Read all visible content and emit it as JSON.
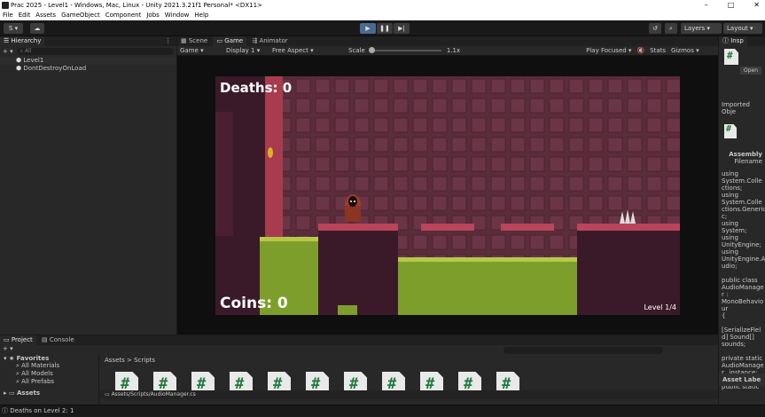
{
  "window": {
    "title": "Prac 2025 - Level1 - Windows, Mac, Linux - Unity 2021.3.21f1 Personal* <DX11>",
    "controls": [
      "–",
      "□",
      "✕"
    ]
  },
  "menu": [
    "File",
    "Edit",
    "Assets",
    "GameObject",
    "Component",
    "Jobs",
    "Window",
    "Help"
  ],
  "toolbar": {
    "account_label": "S ▾",
    "layers_label": "Layers",
    "layout_label": "Layout"
  },
  "hierarchy": {
    "tab_label": "Hierarchy",
    "search_placeholder": "All",
    "items": [
      {
        "label": "Level1"
      },
      {
        "label": "DontDestroyOnLoad"
      }
    ]
  },
  "center_tabs": [
    {
      "label": "Scene"
    },
    {
      "label": "Game"
    },
    {
      "label": "Animator"
    }
  ],
  "game_toolbar": {
    "mode": "Game",
    "display": "Display 1",
    "aspect": "Free Aspect",
    "scale_label": "Scale",
    "scale_value": "1.1x",
    "play_focused": "Play Focused",
    "stats": "Stats",
    "gizmos": "Gizmos"
  },
  "game_view": {
    "deaths_text": "Deaths: 0",
    "coins_text": "Coins: 0",
    "level_text": "Level 1/4"
  },
  "inspector": {
    "tab_label": "Insp",
    "open_button": "Open",
    "imported_label": "Imported Obje",
    "assembly_label": "Assembly",
    "filename_label": "Filename",
    "code_lines": [
      "using",
      "System.Colle",
      "ctions;",
      "using",
      "System.Colle",
      "ctions.Generic",
      "c;",
      "using System;",
      "using",
      "UnityEngine;",
      "using",
      "UnityEngine.A",
      "udio;",
      "",
      "public class",
      "AudioManage",
      "r :",
      "MonoBehavio",
      "ur",
      "{",
      "",
      "[SerializeFiel",
      "d] Sound[]",
      "sounds;",
      "",
      "private static",
      "AudioManage",
      "r _instance;",
      "",
      "public static"
    ],
    "asset_labels": "Asset Labe"
  },
  "project": {
    "tabs": [
      {
        "label": "Project"
      },
      {
        "label": "Console"
      }
    ],
    "favorites_label": "Favorites",
    "favorites": [
      {
        "label": "All Materials"
      },
      {
        "label": "All Models"
      },
      {
        "label": "All Prefabs"
      }
    ],
    "assets_label": "Assets",
    "breadcrumb": [
      "Assets",
      "Scripts"
    ],
    "script_count_visible": 11,
    "path_text": "Assets/Scripts/AudioManager.cs"
  },
  "status_bar": {
    "message": "Deaths on Level 2: 1"
  }
}
